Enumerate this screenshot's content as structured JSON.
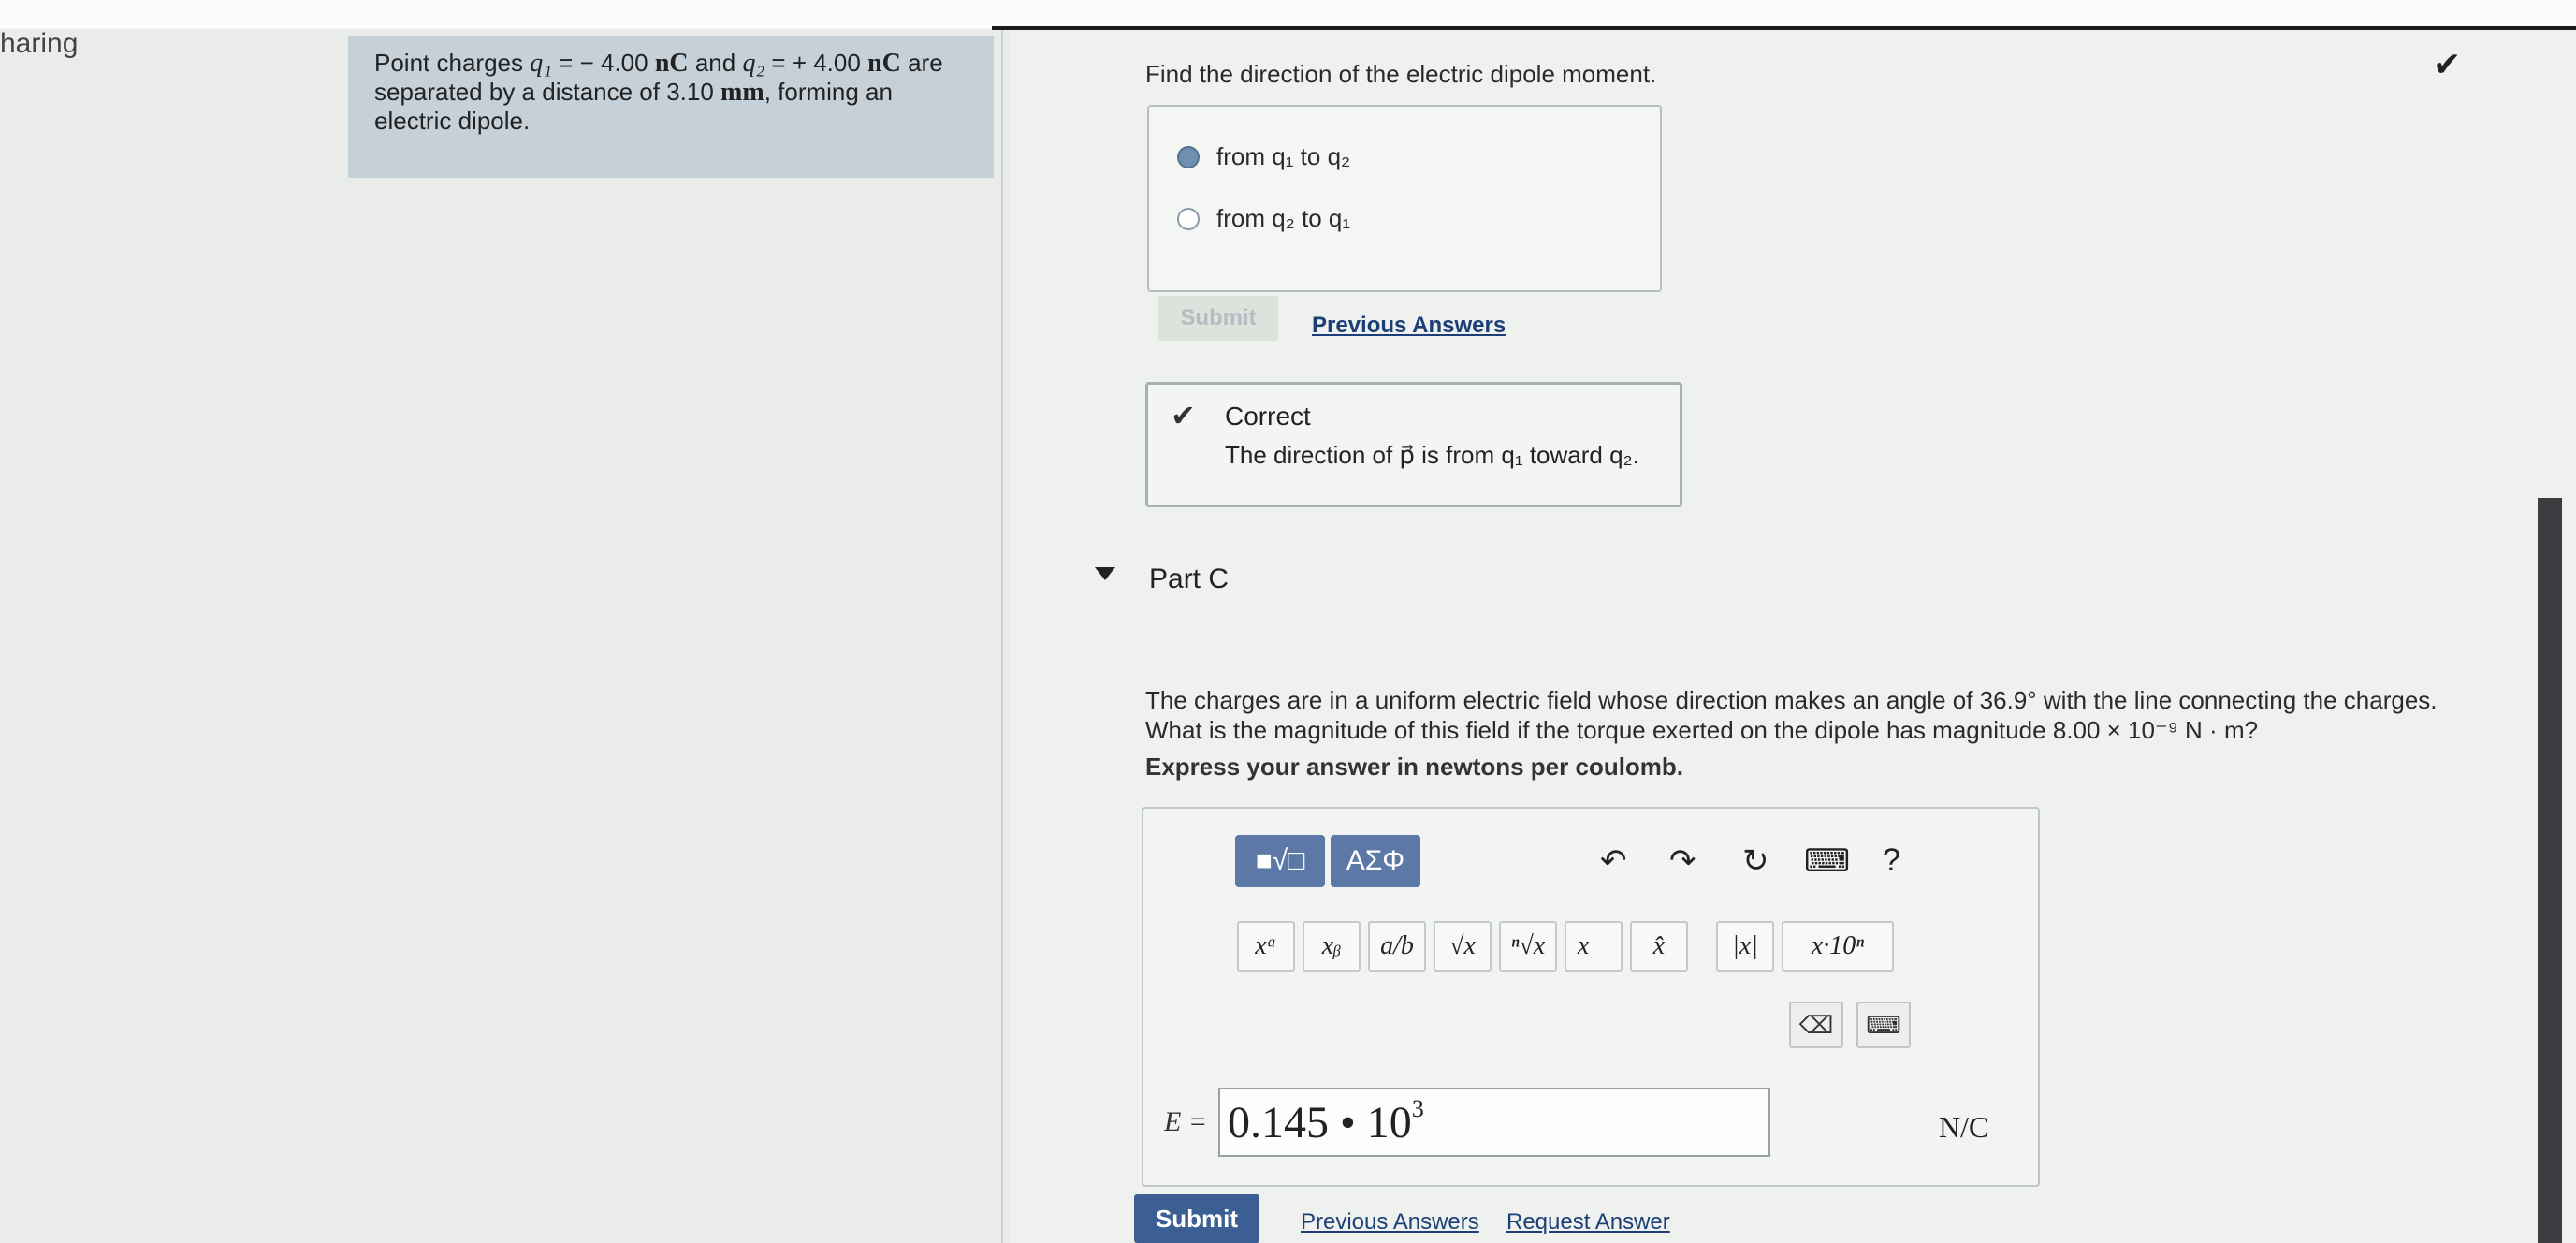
{
  "sidebar": {
    "label": "haring"
  },
  "problem": {
    "t1": "Point charges ",
    "q1": "q₁",
    "t2": " = − 4.00 ",
    "u1": "nC",
    "t3": " and ",
    "q2": "q₂",
    "t4": " = + 4.00 ",
    "u2": "nC",
    "t5": " are separated by a distance of 3.10 ",
    "u3": "mm",
    "t6": ", forming an electric dipole."
  },
  "partB": {
    "question": "Find the direction of the electric dipole moment.",
    "options": [
      {
        "label": "from q₁ to q₂",
        "selected": true
      },
      {
        "label": "from q₂ to q₁",
        "selected": false
      }
    ],
    "submit_label": "Submit",
    "previous_answers_label": "Previous Answers",
    "feedback_title": "Correct",
    "feedback_text": "The direction of p⃗ is from q₁ toward q₂."
  },
  "partC": {
    "title": "Part C",
    "question": "The charges are in a uniform electric field whose direction makes an angle of 36.9° with the line connecting the charges. What is the magnitude of this field if the torque exerted on the dipole has magnitude 8.00 × 10⁻⁹ N · m?",
    "instruction": "Express your answer in newtons per coulomb.",
    "toolbar": {
      "templates_label": "■√□",
      "greek_label": "ΑΣΦ",
      "undo": "↶",
      "redo": "↷",
      "reset": "↻",
      "keyboard": "⌨",
      "help": "?"
    },
    "templates": [
      "xᵃ",
      "xᵦ",
      "a/b",
      "√x",
      "ⁿ√x",
      "x⃗",
      "x̂",
      "|x|",
      "x·10ⁿ"
    ],
    "backspace": "⌫",
    "variable_label": "E =",
    "answer_mantissa": "0.145 • 10",
    "answer_exponent": "3",
    "unit": "N/C",
    "submit_label": "Submit",
    "previous_answers_label": "Previous Answers",
    "request_answer_label": "Request Answer"
  },
  "colors": {
    "primary_button": "#3c5f93",
    "problem_bg": "#c6d0d8",
    "scrollbar": "#3b3d40"
  }
}
